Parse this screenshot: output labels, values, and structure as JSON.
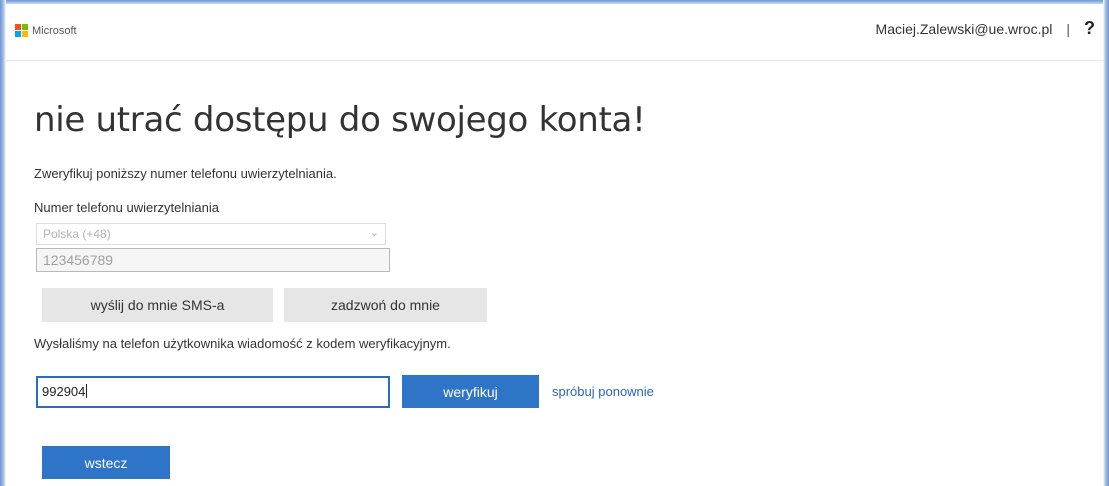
{
  "header": {
    "brand": "Microsoft",
    "user_email": "Maciej.Zalewski@ue.wroc.pl",
    "separator": "|",
    "help_label": "?"
  },
  "main": {
    "title": "nie utrać dostępu do swojego konta!",
    "instruction": "Zweryfikuj poniższy numer telefonu uwierzytelniania.",
    "phone_label": "Numer telefonu uwierzytelniania",
    "country_value": "Polska (+48)",
    "phone_value": "123456789",
    "sms_button": "wyślij do mnie SMS-a",
    "call_button": "zadzwoń do mnie",
    "sent_message": "Wysłaliśmy na telefon użytkownika wiadomość z kodem weryfikacyjnym.",
    "code_value": "992904",
    "verify_button": "weryfikuj",
    "retry_link": "spróbuj ponownie",
    "back_button": "wstecz"
  },
  "colors": {
    "accent": "#2e74c7",
    "link": "#2a65b8",
    "focus_border": "#2d6bbf"
  }
}
